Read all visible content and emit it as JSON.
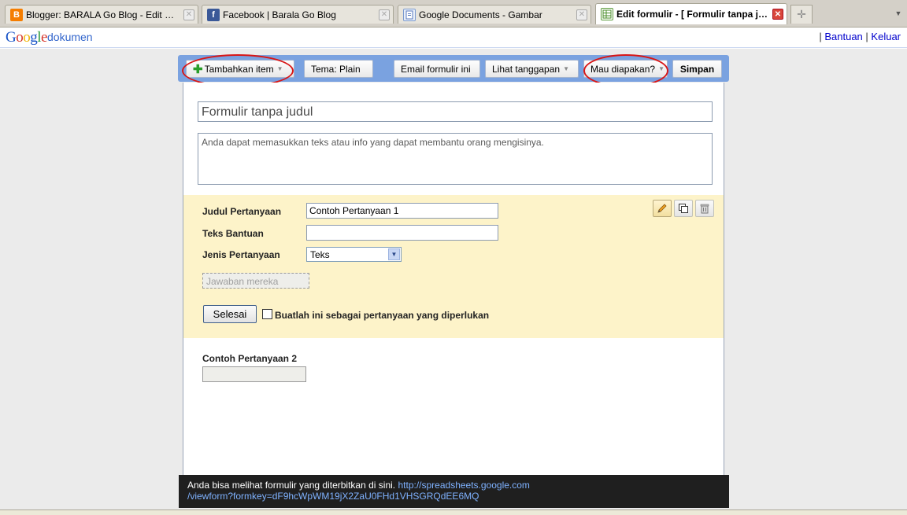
{
  "browser": {
    "tabs": [
      {
        "title": "Blogger: BARALA Go Blog - Edit Entri \" ...",
        "icon": "blogger-icon",
        "active": false
      },
      {
        "title": "Facebook | Barala Go Blog",
        "icon": "facebook-icon",
        "active": false
      },
      {
        "title": "Google Documents - Gambar",
        "icon": "google-docs-icon",
        "active": false
      },
      {
        "title": "Edit formulir - [ Formulir tanpa ju...",
        "icon": "spreadsheet-form-icon",
        "active": true
      }
    ]
  },
  "header": {
    "logo": "Google",
    "product": "dokumen",
    "links": {
      "separator": "|",
      "help": "Bantuan",
      "logout": "Keluar"
    }
  },
  "toolbar": {
    "add_item": "Tambahkan item",
    "theme": "Tema:  Plain",
    "email_form": "Email formulir ini",
    "see_responses": "Lihat tanggapan",
    "more_actions": "Mau diapakan?",
    "save": "Simpan"
  },
  "form": {
    "title": "Formulir tanpa judul",
    "description": "Anda dapat memasukkan teks atau info yang dapat membantu orang mengisinya."
  },
  "question_editor": {
    "title_label": "Judul Pertanyaan",
    "title_value": "Contoh Pertanyaan 1",
    "help_label": "Teks Bantuan",
    "help_value": "",
    "type_label": "Jenis Pertanyaan",
    "type_value": "Teks",
    "answer_placeholder": "Jawaban mereka",
    "done_button": "Selesai",
    "required_label": "Buatlah ini sebagai pertanyaan yang diperlukan"
  },
  "question2": {
    "title": "Contoh Pertanyaan 2"
  },
  "notice": {
    "text": "Anda bisa melihat formulir yang diterbitkan di sini.",
    "url_part1": "http://spreadsheets.google.com",
    "url_part2": "/viewform?formkey=dF9hcWpWM19jX2ZaU0FHd1VHSGRQdEE6MQ"
  },
  "colors": {
    "toolbar_bg": "#7aa2e0",
    "question_edit_bg": "#fdf3c9",
    "annotation_ring": "#d81616",
    "link": "#0000cc"
  }
}
